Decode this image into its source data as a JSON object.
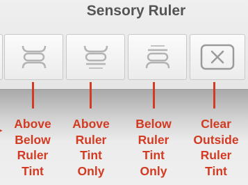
{
  "panel_title": "Sensory Ruler",
  "buttons": [
    {
      "name": "above-below-ruler-tint-button",
      "icon": "ruler-tint-above-below-icon"
    },
    {
      "name": "above-ruler-tint-only-button",
      "icon": "ruler-tint-above-icon"
    },
    {
      "name": "below-ruler-tint-only-button",
      "icon": "ruler-tint-below-icon"
    },
    {
      "name": "clear-outside-ruler-tint-button",
      "icon": "clear-x-icon"
    }
  ],
  "labels": [
    [
      "Above",
      "Below",
      "Ruler",
      "Tint"
    ],
    [
      "Above",
      "Ruler",
      "Tint",
      "Only"
    ],
    [
      "Below",
      "Ruler",
      "Tint",
      "Only"
    ],
    [
      "Clear",
      "Outside",
      "Ruler",
      "Tint"
    ]
  ],
  "accent_color": "#d23a22"
}
